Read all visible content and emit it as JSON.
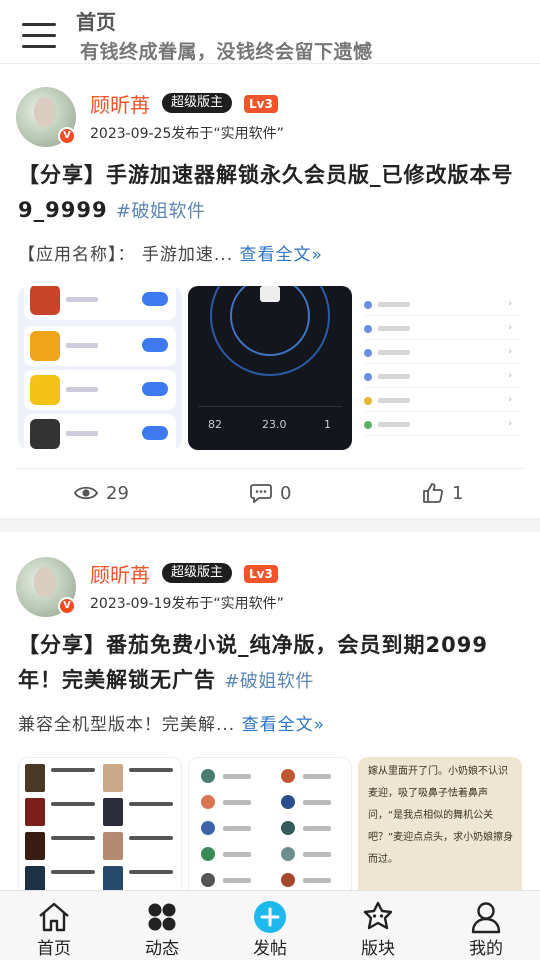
{
  "header": {
    "title": "首页",
    "subtitle": "有钱终成眷属，没钱终会留下遗憾"
  },
  "posts": [
    {
      "author": "顾昕苒",
      "role_badge": "超级版主",
      "level_badge": "Lv3",
      "avatar_badge": "V",
      "meta": "2023-09-25发布于“实用软件”",
      "title": "【分享】手游加速器解锁永久会员版_已修改版本号9_9999",
      "tag": "#破姐软件",
      "excerpt": "【应用名称】： 手游加速...",
      "read_more": "查看全文»",
      "dark_thumb_numbers": [
        "82",
        "23.0",
        "1"
      ],
      "views": "29",
      "comments": "0",
      "likes": "1"
    },
    {
      "author": "顾昕苒",
      "role_badge": "超级版主",
      "level_badge": "Lv3",
      "avatar_badge": "V",
      "meta": "2023-09-19发布于“实用软件”",
      "title": "【分享】番茄免费小说_纯净版，会员到期2099年！完美解锁无广告",
      "tag": "#破姐软件",
      "excerpt": "兼容全机型版本！完美解...",
      "read_more": "查看全文»",
      "novel_text": "嫁从里面开了门。小奶娘不认识麦迎，吸了吸鼻子怯着鼻声问，“是我点相似的舞机公关吧？”麦迎点点头，求小奶娘擦身而过。"
    }
  ],
  "tabbar": {
    "tabs": [
      {
        "label": "首页",
        "icon": "home-icon"
      },
      {
        "label": "动态",
        "icon": "apps-icon"
      },
      {
        "label": "发帖",
        "icon": "plus-circle-icon"
      },
      {
        "label": "版块",
        "icon": "forum-icon"
      },
      {
        "label": "我的",
        "icon": "user-icon"
      }
    ]
  },
  "colors": {
    "accent": "#f2552c",
    "link": "#2f75c8",
    "tag": "#5a86b5",
    "post_button": "#1fb8ec"
  }
}
